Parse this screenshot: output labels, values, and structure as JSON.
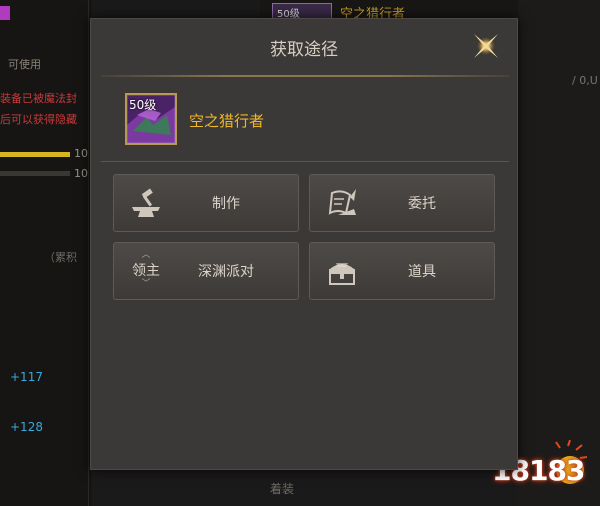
{
  "dialog": {
    "title": "获取途径",
    "item": {
      "level_badge": "50级",
      "name": "空之猎行者"
    },
    "sources": [
      {
        "label": "制作",
        "icon": "anvil-hammer-icon"
      },
      {
        "label": "委托",
        "icon": "scroll-quill-icon"
      },
      {
        "label": "深渊派对",
        "icon_text": "领主",
        "icon": "lord-badge-icon"
      },
      {
        "label": "道具",
        "icon": "treasure-chest-icon"
      }
    ]
  },
  "background": {
    "left_texts": [
      "可使用",
      "装备已被魔法封",
      "后可以获得隐藏",
      "10",
      "10",
      "（累积",
      "+117",
      "+128"
    ],
    "top_thumb_level": "50级",
    "top_title": "空之猎行者",
    "right_text": "/ 0,U",
    "bottom_text": "着装",
    "logo": "18183"
  },
  "colors": {
    "accent_gold": "#f0b626",
    "magenta": "#c040c0",
    "cyan": "#3aa8d8",
    "red_text": "#c83a3a"
  }
}
